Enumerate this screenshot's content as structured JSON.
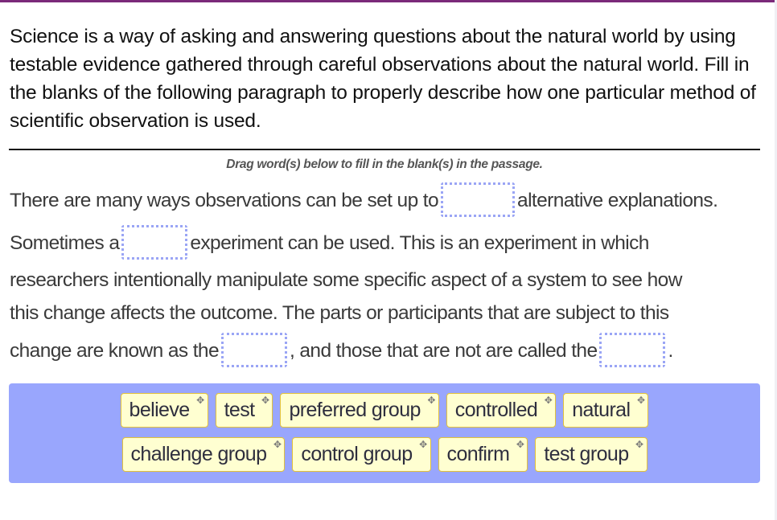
{
  "prompt": "Science is a way of asking and answering questions about the natural world by using testable evidence gathered through careful observations about the natural world. Fill in the blanks of the following paragraph to properly describe how one particular method of scientific observation is used.",
  "instruction": "Drag word(s) below to fill in the blank(s) in the passage.",
  "passage": {
    "line1_before": "There are many ways observations can be set up to",
    "line1_after": "alternative explanations.",
    "line2_before": "Sometimes a",
    "line2_after": "experiment can be used. This is an experiment in which",
    "line3": "researchers intentionally manipulate some specific aspect of a system to see how",
    "line4": "this change affects the outcome. The parts or participants that are subject to this",
    "line5_before": "change are known as the",
    "line5_middle": ", and those that are not are called the",
    "line5_after": "."
  },
  "blanks": [
    {
      "id": 1,
      "value": ""
    },
    {
      "id": 2,
      "value": ""
    },
    {
      "id": 3,
      "value": ""
    },
    {
      "id": 4,
      "value": ""
    }
  ],
  "word_bank": {
    "row1": [
      "believe",
      "test",
      "preferred group",
      "controlled",
      "natural"
    ],
    "row2": [
      "challenge group",
      "control group",
      "confirm",
      "test group"
    ],
    "move_icon": "✥"
  },
  "colors": {
    "top_border": "#7b2a7a",
    "blank_border": "#9aa5f5",
    "word_bank_bg": "#99a6fd",
    "tile_bg": "#ffffd1",
    "tile_border": "#e2c13a"
  }
}
